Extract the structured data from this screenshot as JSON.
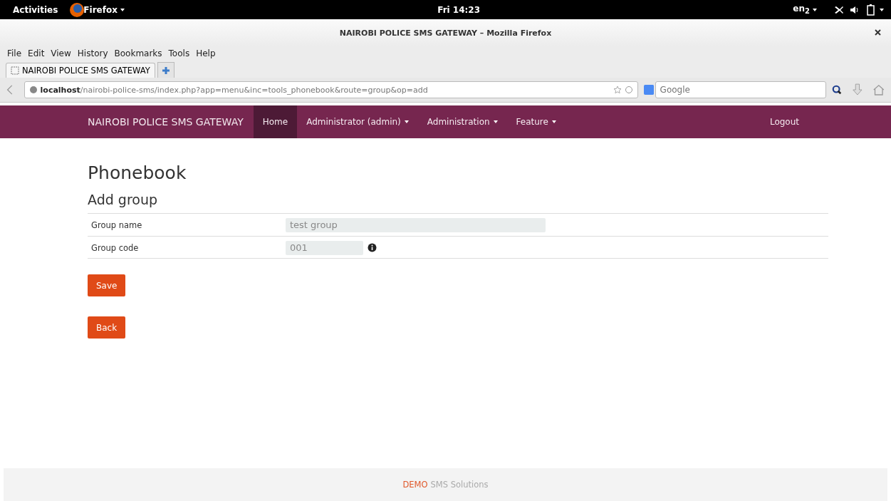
{
  "top_bar": {
    "activities": "Activities",
    "app_menu": "Firefox",
    "clock": "Fri 14:23",
    "keyboard": "en$_{2}$"
  },
  "window": {
    "title": "NAIROBI POLICE SMS GATEWAY – Mozilla Firefox"
  },
  "menu_bar": [
    "File",
    "Edit",
    "View",
    "History",
    "Bookmarks",
    "Tools",
    "Help"
  ],
  "tabs": [
    {
      "label": "NAIROBI POLICE SMS GATEWAY",
      "selected": true
    }
  ],
  "url_bar": {
    "host": "localhost",
    "path": "/nairobi-police-sms/index.php?app=menu&inc=tools_phonebook&route=group&op=add"
  },
  "search": {
    "placeholder": "Google"
  },
  "navbar": {
    "brand": "NAIROBI POLICE SMS GATEWAY",
    "items": [
      {
        "label": "Home",
        "selected": true,
        "dropdown": false
      },
      {
        "label": "Administrator (admin)",
        "selected": false,
        "dropdown": true
      },
      {
        "label": "Administration",
        "selected": false,
        "dropdown": true
      },
      {
        "label": "Feature",
        "selected": false,
        "dropdown": true
      }
    ],
    "logout": "Logout"
  },
  "page": {
    "title": "Phonebook",
    "subtitle": "Add group",
    "fields": [
      {
        "label": "Group name",
        "value": "test group",
        "kind": "wide"
      },
      {
        "label": "Group code",
        "value": "001",
        "kind": "short"
      }
    ],
    "buttons": [
      "Save",
      "Back"
    ]
  },
  "footer": {
    "brand": "DEMO",
    "text": "SMS Solutions"
  }
}
